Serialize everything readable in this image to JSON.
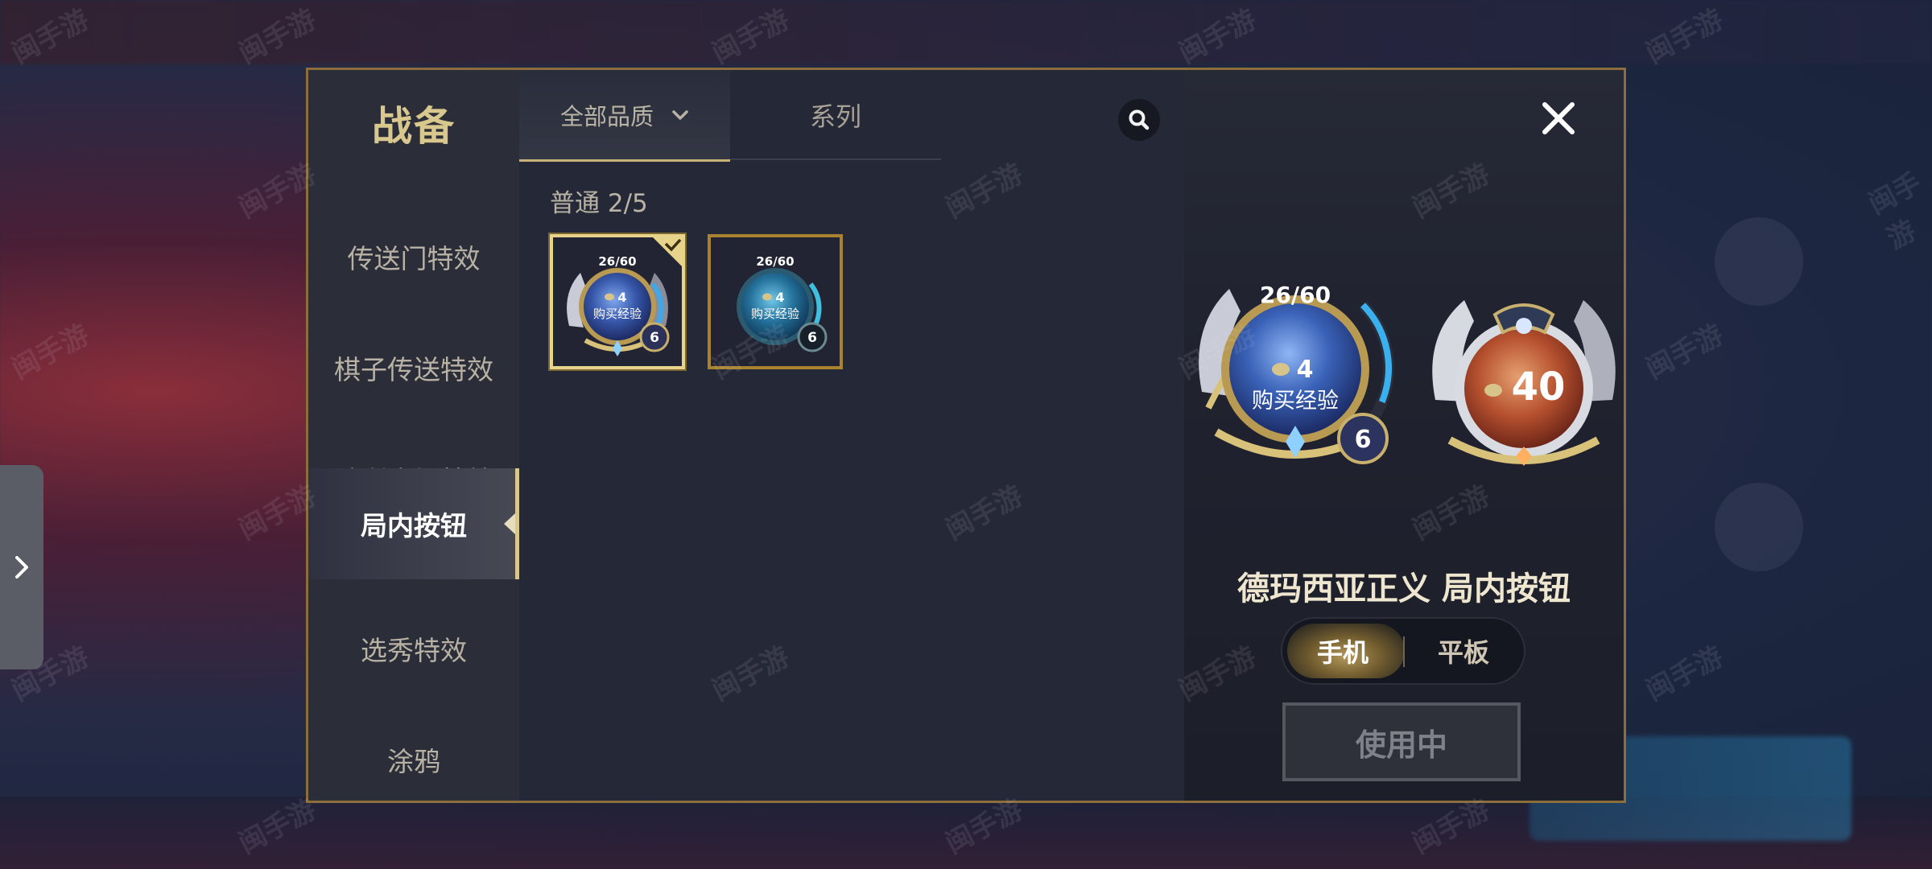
{
  "nav": {
    "title": "战备",
    "items": [
      {
        "label": "传送门特效",
        "active": false
      },
      {
        "label": "棋子传送特效",
        "active": false
      },
      {
        "label": "胜利庆祝特效",
        "active": false
      },
      {
        "label": "局内按钮",
        "active": true
      },
      {
        "label": "选秀特效",
        "active": false
      },
      {
        "label": "涂鸦",
        "active": false
      }
    ]
  },
  "filters": {
    "quality_label": "全部品质",
    "series_label": "系列"
  },
  "section": {
    "label": "普通 2/5"
  },
  "items": [
    {
      "xp": "26/60",
      "cost": "4",
      "button_text": "购买经验",
      "level": "6",
      "selected": true
    },
    {
      "xp": "26/60",
      "cost": "4",
      "button_text": "购买经验",
      "level": "6",
      "selected": false
    }
  ],
  "preview": {
    "xp": "26/60",
    "cost": "4",
    "button_text": "购买经验",
    "level": "6",
    "refresh_value": "40",
    "name": "德玛西亚正义 局内按钮",
    "device_phone": "手机",
    "device_tablet": "平板",
    "use_status": "使用中"
  },
  "watermark": "闽手游",
  "colors": {
    "gold_accent": "#d9c88e",
    "frame_gold": "#8c6d3c",
    "panel_bg": "#242735",
    "orb_blue": "#3a62b8",
    "orb_red": "#b5502e"
  }
}
